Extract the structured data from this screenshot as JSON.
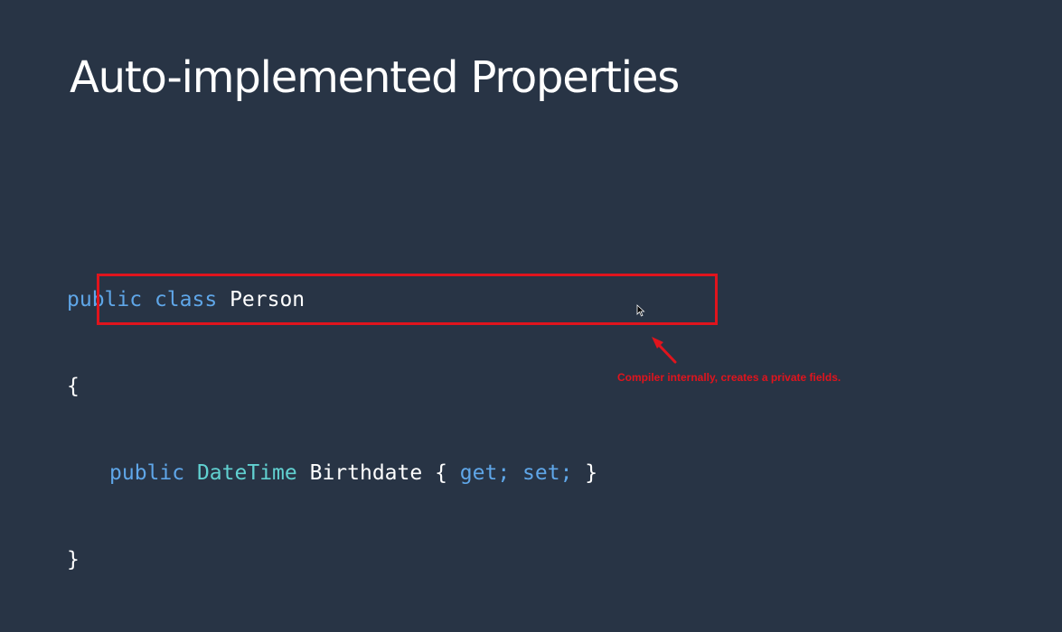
{
  "slide": {
    "title": "Auto-implemented Properties",
    "background_color": "#283445"
  },
  "code": {
    "line1": {
      "keyword_public": "public",
      "keyword_class": "class",
      "name": "Person"
    },
    "open_brace": "{",
    "line3": {
      "keyword_public": "public",
      "type": "DateTime",
      "name": "Birthdate",
      "open": "{",
      "get": "get;",
      "set": "set;",
      "close": "}"
    },
    "close_brace": "}"
  },
  "colors": {
    "keyword": "#5fa6e8",
    "type": "#61d1d1",
    "text": "#ffffff",
    "annotation": "#e0141d"
  },
  "annotation": {
    "text": "Compiler internally, creates a private fields."
  },
  "icons": {
    "cursor": "mouse-pointer-icon",
    "arrow": "arrow-pointer-icon"
  }
}
